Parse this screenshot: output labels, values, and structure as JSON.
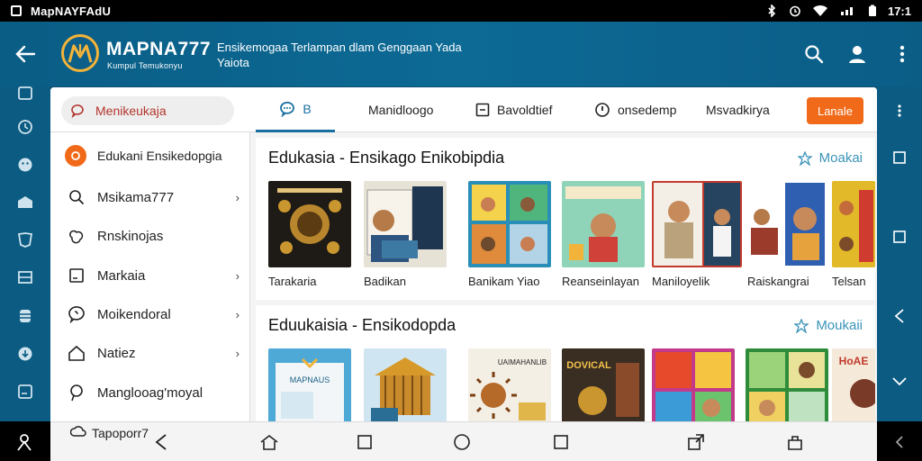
{
  "status": {
    "app_title": "MapNAYFAdU",
    "time": "17:1"
  },
  "header": {
    "brand": "MAPNA777",
    "brand_sub": "Kumpul Temukonyu",
    "tagline": "Ensikemogaa Terlampan dlam Genggaan Yada Yaiota"
  },
  "toolbar": {
    "search_placeholder": "Menikeukaja",
    "tabs": [
      {
        "label": "B",
        "icon": "chat-icon",
        "active": true
      },
      {
        "label": "Manidloogo",
        "icon": ""
      },
      {
        "label": "Bavoldtief",
        "icon": "square-minus-icon"
      },
      {
        "label": "onsedemp",
        "icon": "compass-icon"
      },
      {
        "label": "Msvadkirya",
        "icon": ""
      }
    ],
    "action_button": "Lanale"
  },
  "drawer": {
    "header": "Edukani Ensikedopgia",
    "items": [
      {
        "label": "Msikama777",
        "icon": "search-icon",
        "chevron": true
      },
      {
        "label": "Rnskinojas",
        "icon": "sparkle-icon",
        "chevron": false
      },
      {
        "label": "Markaia",
        "icon": "book-icon",
        "chevron": true
      },
      {
        "label": "Moikendoral",
        "icon": "chat-icon",
        "chevron": true
      },
      {
        "label": "Natiez",
        "icon": "home-icon",
        "chevron": true
      },
      {
        "label": "Manglooag'moyal",
        "icon": "pin-icon",
        "chevron": false
      }
    ],
    "partial_item": "Tapoporr7"
  },
  "sections": [
    {
      "title": "Edukasia - Ensikago Enikobipdia",
      "more": "Moakai",
      "books": [
        {
          "label": "Tarakaria",
          "color": "#1e1a15"
        },
        {
          "label": "Badikan",
          "color": "#e6e2d6"
        },
        {
          "label": "Banikam Yiao",
          "color": "#2a8fb8"
        },
        {
          "label": "Reanseinlayan",
          "color": "#8fd4b8"
        },
        {
          "label": "Maniloyelik",
          "color": "#c23a2e"
        },
        {
          "label": "Raiskangrai",
          "color": "#2f5fb0"
        },
        {
          "label": "Telsan",
          "color": "#e2b928"
        }
      ]
    },
    {
      "title": "Eduukaisia - Ensikodopda",
      "more": "Moukaii",
      "books": [
        {
          "label": "",
          "color": "#4fa9d6",
          "cover_text": "MAPNAUS"
        },
        {
          "label": "",
          "color": "#cfe6f2"
        },
        {
          "label": "",
          "color": "#f4efe4",
          "cover_text": "UAIMAHANLIB"
        },
        {
          "label": "",
          "color": "#3a2d22",
          "cover_text": "DOVICAL"
        },
        {
          "label": "",
          "color": "#c33a8a"
        },
        {
          "label": "",
          "color": "#2f8c3a"
        },
        {
          "label": "",
          "color": "#f5e9da",
          "cover_text": "HoAE"
        }
      ]
    }
  ]
}
